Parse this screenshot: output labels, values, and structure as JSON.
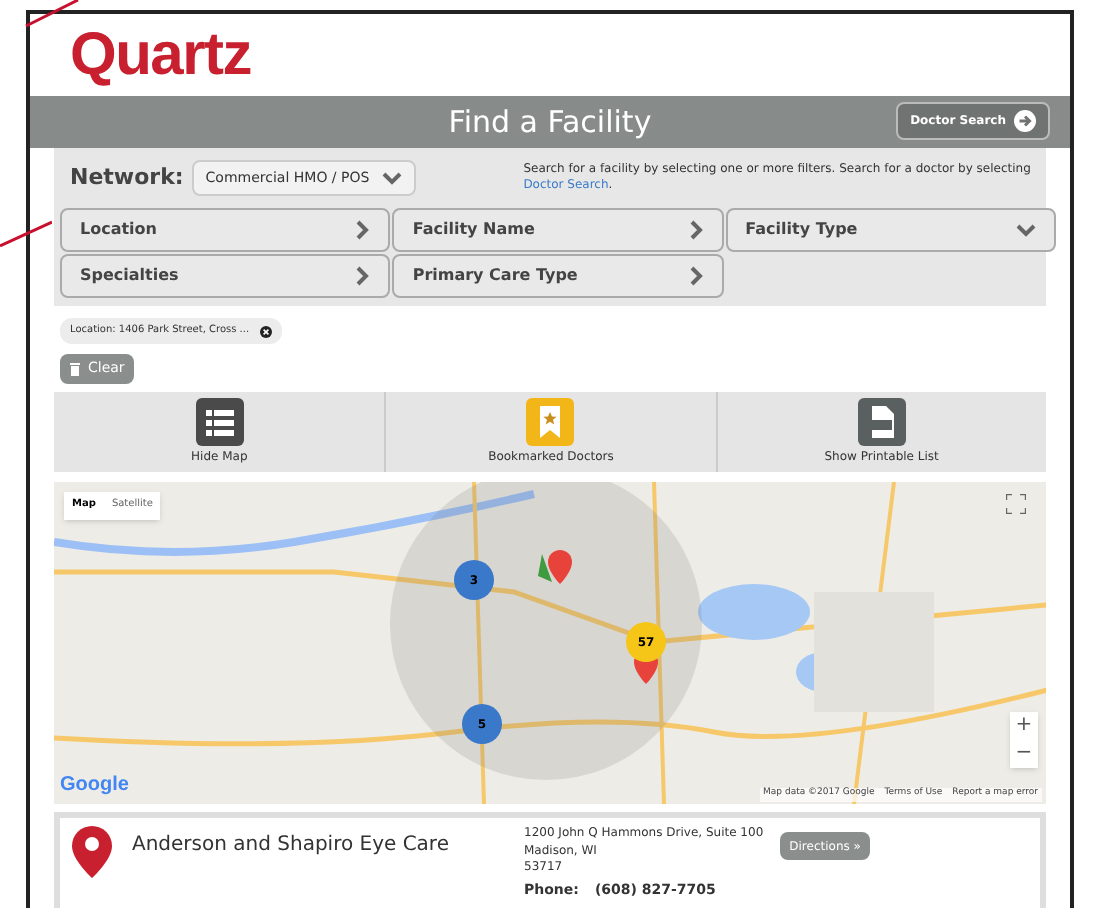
{
  "logo": "Quartz",
  "header": {
    "title": "Find a Facility",
    "button": "Doctor Search"
  },
  "network": {
    "label": "Network:",
    "value": "Commercial HMO / POS"
  },
  "help": {
    "text": "Search for a facility by selecting one or more filters. Search for a doctor by selecting",
    "link": "Doctor Search",
    "end": "."
  },
  "filters": [
    {
      "label": "Location",
      "kind": "drawer"
    },
    {
      "label": "Facility Name",
      "kind": "drawer"
    },
    {
      "label": "Facility Type",
      "kind": "dropdown"
    },
    {
      "label": "Specialties",
      "kind": "drawer"
    },
    {
      "label": "Primary Care Type",
      "kind": "drawer"
    }
  ],
  "chips": [
    {
      "label": "Location: 1406 Park Street, Cross ..."
    }
  ],
  "clear_button": "Clear",
  "actions": [
    {
      "label": "Hide Map",
      "kind": "list"
    },
    {
      "label": "Bookmarked Doctors",
      "kind": "bookmark"
    },
    {
      "label": "Show Printable List",
      "kind": "pdf"
    }
  ],
  "map": {
    "types": [
      {
        "label": "Map",
        "selected": true
      },
      {
        "label": "Satellite",
        "selected": false
      }
    ],
    "clusters": [
      {
        "count": "3",
        "color": "#3a78c9"
      },
      {
        "count": "5",
        "color": "#3a78c9"
      },
      {
        "count": "57",
        "color": "#f5c518"
      }
    ],
    "zoom_in": "+",
    "zoom_out": "−",
    "logo": "Google",
    "attribution": [
      "Map data ©2017 Google",
      "Terms of Use",
      "Report a map error"
    ]
  },
  "results": [
    {
      "name": "Anderson and Shapiro Eye Care",
      "address": [
        "1200 John Q Hammons Drive, Suite 100",
        "Madison, WI",
        "53717"
      ],
      "phone_label": "Phone:",
      "phone": "(608) 827-7705",
      "button": "Directions »"
    }
  ]
}
